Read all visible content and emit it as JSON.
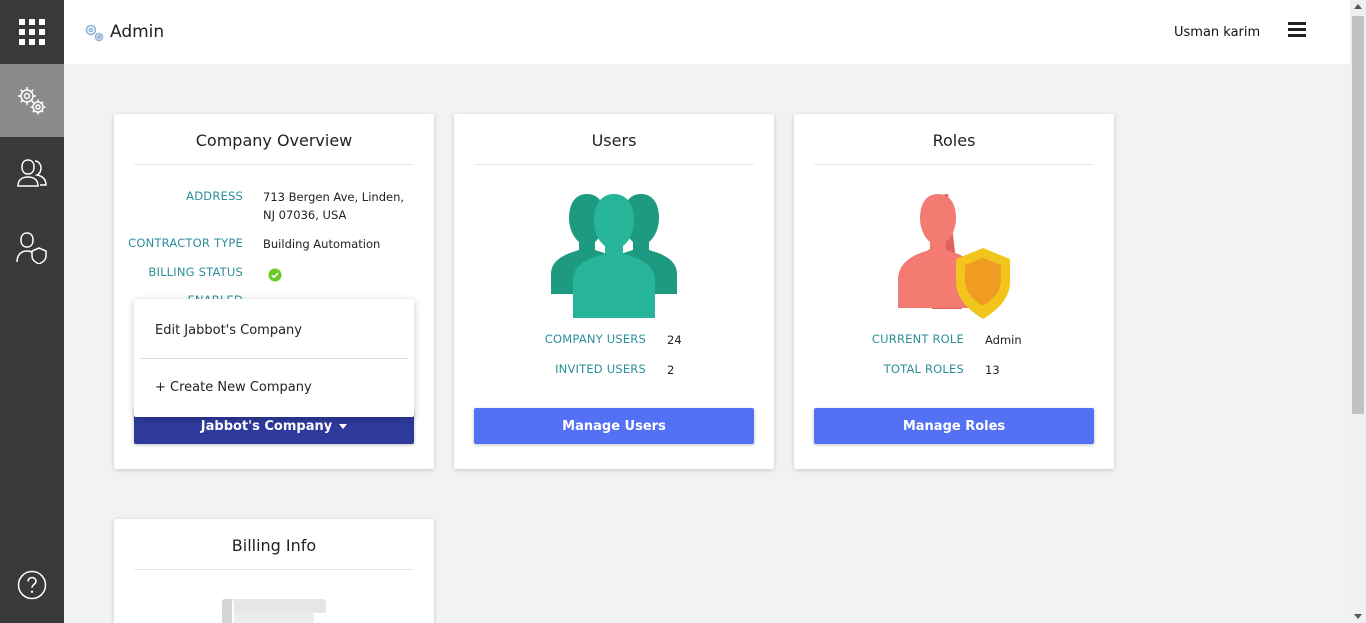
{
  "topbar": {
    "title": "Admin",
    "user_name": "Usman karim"
  },
  "sidebar": {
    "items": [
      "apps",
      "admin-settings",
      "users",
      "roles",
      "help"
    ]
  },
  "company_card": {
    "title": "Company Overview",
    "address_label": "ADDRESS",
    "address_line1": "713 Bergen Ave, Linden,",
    "address_line2": "NJ 07036, USA",
    "contractor_type_label": "CONTRACTOR TYPE",
    "contractor_type": "Building Automation",
    "billing_status_label": "BILLING STATUS",
    "enabled_label": "ENABLED",
    "company_button": "Jabbot's Company"
  },
  "company_dropdown": {
    "edit_label": "Edit Jabbot's Company",
    "create_label": "+ Create New Company"
  },
  "users_card": {
    "title": "Users",
    "company_users_label": "COMPANY USERS",
    "company_users_value": "24",
    "invited_users_label": "INVITED USERS",
    "invited_users_value": "2",
    "button": "Manage Users"
  },
  "roles_card": {
    "title": "Roles",
    "current_role_label": "CURRENT ROLE",
    "current_role_value": "Admin",
    "total_roles_label": "TOTAL ROLES",
    "total_roles_value": "13",
    "button": "Manage Roles"
  },
  "billing_card": {
    "title": "Billing Info"
  },
  "colors": {
    "sidebar_bg": "#393939",
    "sidebar_active": "#8a8a8a",
    "label_teal": "#2b8f9b",
    "button_blue": "#5470f5",
    "button_navy": "#2e3a9c",
    "users_teal": "#26b598",
    "roles_salmon": "#f47b72",
    "shield_yellow": "#f2c51c",
    "status_green": "#6cc926"
  }
}
